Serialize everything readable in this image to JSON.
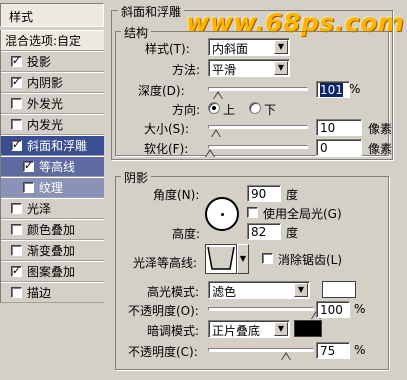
{
  "watermark": "www.68ps.com",
  "sidebar": {
    "header": "样式",
    "items": [
      {
        "label": "混合选项:自定",
        "checkbox": false,
        "checked": false,
        "state": "blend"
      },
      {
        "label": "投影",
        "checkbox": true,
        "checked": true
      },
      {
        "label": "内阴影",
        "checkbox": true,
        "checked": true
      },
      {
        "label": "外发光",
        "checkbox": true,
        "checked": false
      },
      {
        "label": "内发光",
        "checkbox": true,
        "checked": false
      },
      {
        "label": "斜面和浮雕",
        "checkbox": true,
        "checked": true,
        "state": "selected"
      },
      {
        "label": "等高线",
        "checkbox": true,
        "checked": true,
        "state": "sub-active"
      },
      {
        "label": "纹理",
        "checkbox": true,
        "checked": false,
        "state": "sub"
      },
      {
        "label": "光泽",
        "checkbox": true,
        "checked": false
      },
      {
        "label": "颜色叠加",
        "checkbox": true,
        "checked": false
      },
      {
        "label": "渐变叠加",
        "checkbox": true,
        "checked": false
      },
      {
        "label": "图案叠加",
        "checkbox": true,
        "checked": true
      },
      {
        "label": "描边",
        "checkbox": true,
        "checked": false
      }
    ]
  },
  "bevel": {
    "title": "斜面和浮雕",
    "structure_title": "结构",
    "style_label": "样式(T):",
    "style_value": "内斜面",
    "method_label": "方法:",
    "method_value": "平滑",
    "depth_label": "深度(D):",
    "depth_value": "101",
    "depth_unit": "%",
    "depth_level": 10,
    "direction_label": "方向:",
    "dir_up": "上",
    "dir_down": "下",
    "size_label": "大小(S):",
    "size_value": "10",
    "size_unit": "像素",
    "size_level": 4,
    "soften_label": "软化(F):",
    "soften_value": "0",
    "soften_unit": "像素",
    "soften_level": 0
  },
  "shading": {
    "title": "阴影",
    "angle_label": "角度(N):",
    "angle_value": "90",
    "angle_unit": "度",
    "global_light_label": "使用全局光(G)",
    "altitude_label": "高度:",
    "altitude_value": "82",
    "altitude_unit": "度",
    "gloss_label": "光泽等高线:",
    "antialias_label": "消除锯齿(L)",
    "highlight_mode_label": "高光模式:",
    "highlight_mode_value": "滤色",
    "highlight_color": "#ffffff",
    "opacity1_label": "不透明度(O):",
    "opacity1_value": "100",
    "opacity1_unit": "%",
    "opacity1_level": 100,
    "shadow_mode_label": "暗调模式:",
    "shadow_mode_value": "正片叠底",
    "shadow_color": "#000000",
    "opacity2_label": "不透明度(C):",
    "opacity2_value": "75",
    "opacity2_unit": "%",
    "opacity2_level": 75
  }
}
